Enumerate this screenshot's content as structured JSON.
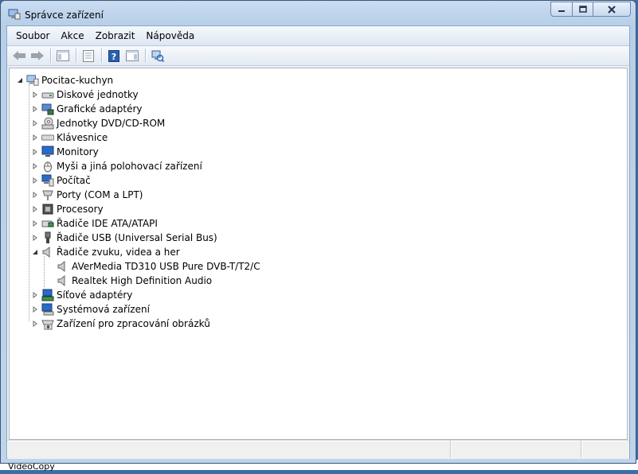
{
  "window": {
    "title": "Správce zařízení"
  },
  "menu": [
    "Soubor",
    "Akce",
    "Zobrazit",
    "Nápověda"
  ],
  "toolbar": {
    "buttons": [
      "back-arrow-icon",
      "forward-arrow-icon",
      "show-hide-console-tree-icon",
      "properties-icon",
      "help-icon",
      "action-pane-icon",
      "scan-hardware-icon"
    ]
  },
  "tree": {
    "root": {
      "label": "Pocitac-kuchyn",
      "icon": "computer-icon",
      "expanded": true
    },
    "categories": [
      {
        "label": "Diskové jednotky",
        "icon": "disk-drive-icon"
      },
      {
        "label": "Grafické adaptéry",
        "icon": "display-adapter-icon"
      },
      {
        "label": "Jednotky DVD/CD-ROM",
        "icon": "dvd-drive-icon"
      },
      {
        "label": "Klávesnice",
        "icon": "keyboard-icon"
      },
      {
        "label": "Monitory",
        "icon": "monitor-icon"
      },
      {
        "label": "Myši a jiná polohovací zařízení",
        "icon": "mouse-icon"
      },
      {
        "label": "Počítač",
        "icon": "computer-icon"
      },
      {
        "label": "Porty (COM a LPT)",
        "icon": "port-icon"
      },
      {
        "label": "Procesory",
        "icon": "processor-icon"
      },
      {
        "label": "Řadiče IDE ATA/ATAPI",
        "icon": "ide-controller-icon"
      },
      {
        "label": "Řadiče USB (Universal Serial Bus)",
        "icon": "usb-controller-icon"
      },
      {
        "label": "Řadiče zvuku, videa a her",
        "icon": "sound-icon",
        "expanded": true,
        "children": [
          {
            "label": "AVerMedia TD310 USB Pure DVB-T/T2/C",
            "icon": "speaker-icon"
          },
          {
            "label": "Realtek High Definition Audio",
            "icon": "speaker-icon"
          }
        ]
      },
      {
        "label": "Síťové adaptéry",
        "icon": "network-adapter-icon"
      },
      {
        "label": "Systémová zařízení",
        "icon": "system-device-icon"
      },
      {
        "label": "Zařízení pro zpracování obrázků",
        "icon": "imaging-device-icon"
      }
    ]
  },
  "background_text": "VideoCopy",
  "colors": {
    "title_gradient_top": "#c9dcf1",
    "accent_blue": "#2a6ac8",
    "selection": "#3399ff"
  }
}
